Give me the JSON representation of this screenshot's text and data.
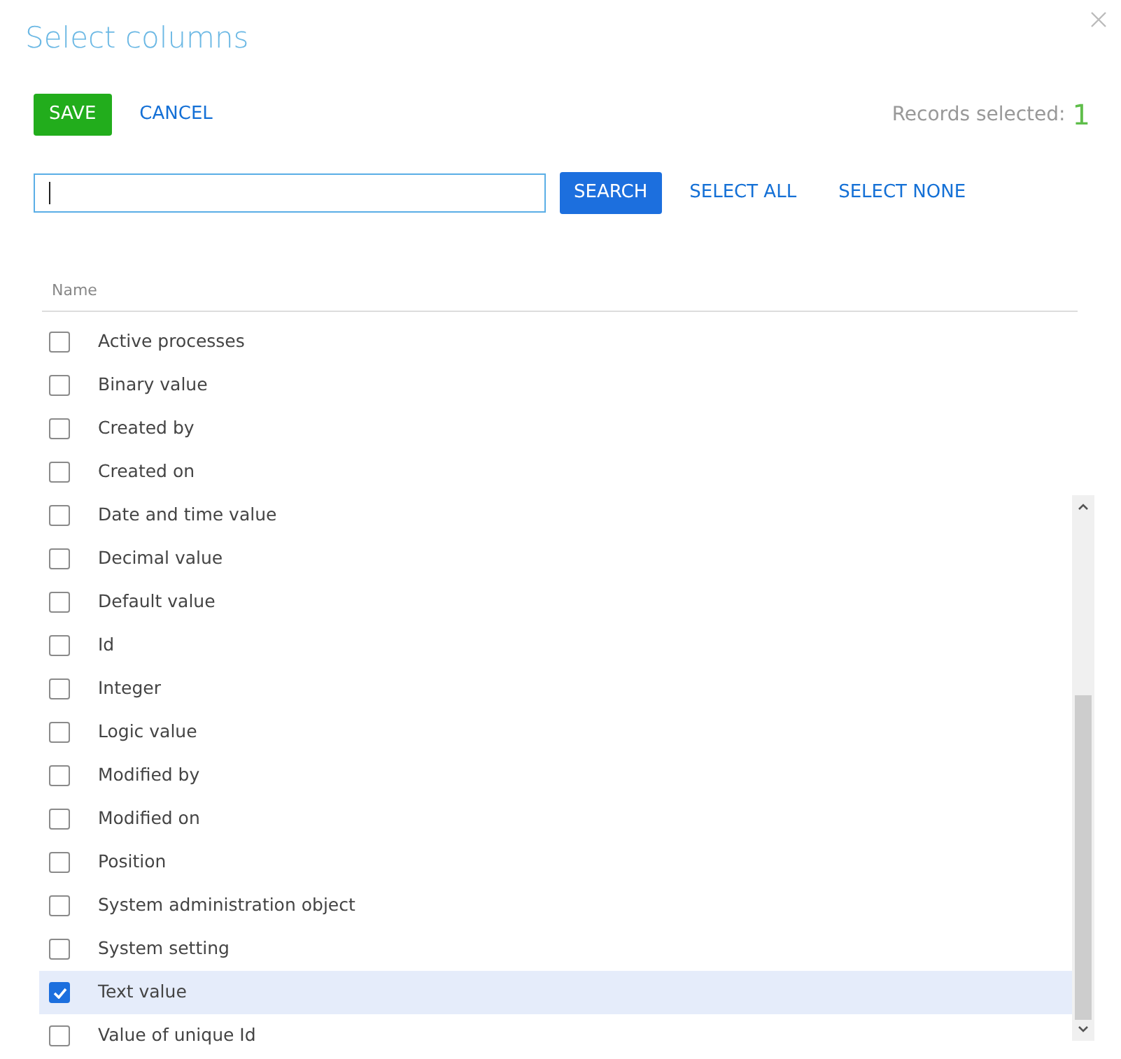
{
  "window": {
    "title": "Select columns"
  },
  "toolbar": {
    "save": "SAVE",
    "cancel": "CANCEL",
    "records_label": "Records selected:",
    "records_count": "1"
  },
  "search": {
    "focused": true,
    "button": "SEARCH",
    "select_all": "SELECT ALL",
    "select_none": "SELECT NONE"
  },
  "table": {
    "columns": [
      "Name"
    ],
    "rows": [
      {
        "label": "Active processes",
        "checked": false,
        "selected": false
      },
      {
        "label": "Binary value",
        "checked": false,
        "selected": false
      },
      {
        "label": "Created by",
        "checked": false,
        "selected": false
      },
      {
        "label": "Created on",
        "checked": false,
        "selected": false
      },
      {
        "label": "Date and time value",
        "checked": false,
        "selected": false
      },
      {
        "label": "Decimal value",
        "checked": false,
        "selected": false
      },
      {
        "label": "Default value",
        "checked": false,
        "selected": false
      },
      {
        "label": "Id",
        "checked": false,
        "selected": false
      },
      {
        "label": "Integer",
        "checked": false,
        "selected": false
      },
      {
        "label": "Logic value",
        "checked": false,
        "selected": false
      },
      {
        "label": "Modified by",
        "checked": false,
        "selected": false
      },
      {
        "label": "Modified on",
        "checked": false,
        "selected": false
      },
      {
        "label": "Position",
        "checked": false,
        "selected": false
      },
      {
        "label": "System administration object",
        "checked": false,
        "selected": false
      },
      {
        "label": "System setting",
        "checked": false,
        "selected": false
      },
      {
        "label": "Text value",
        "checked": true,
        "selected": true
      },
      {
        "label": "Value of unique Id",
        "checked": false,
        "selected": false
      }
    ]
  }
}
